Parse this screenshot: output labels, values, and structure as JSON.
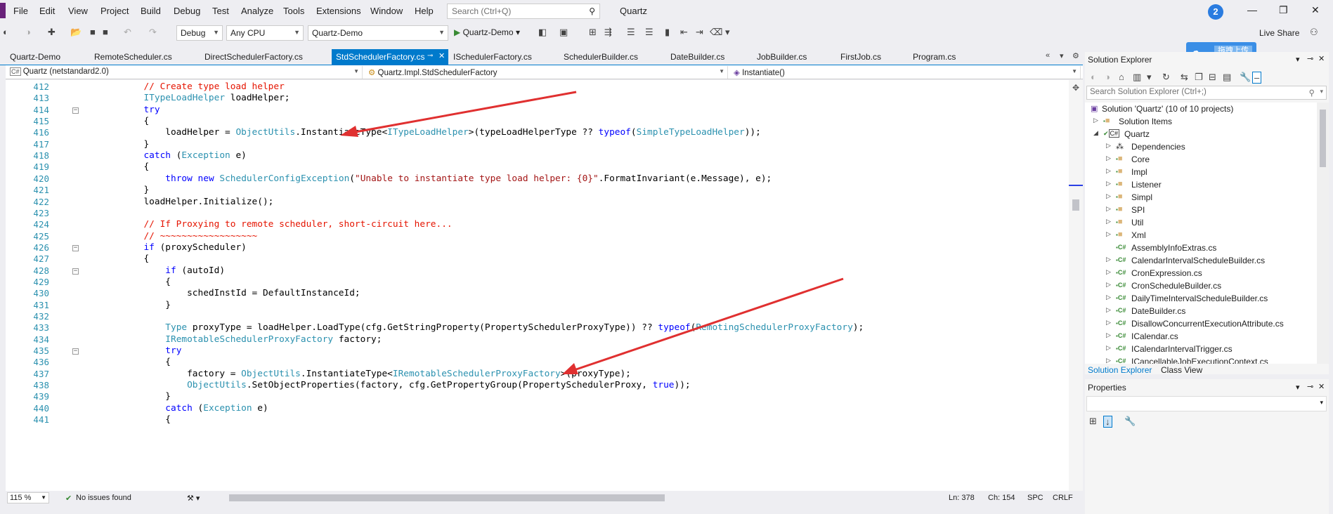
{
  "menubar": {
    "items": [
      "File",
      "Edit",
      "View",
      "Project",
      "Build",
      "Debug",
      "Test",
      "Analyze",
      "Tools",
      "Extensions",
      "Window",
      "Help"
    ],
    "search_placeholder": "Search (Ctrl+Q)",
    "app_title": "Quartz",
    "notification_count": "2",
    "upload_label": "拖拽上传",
    "live_share": "Live Share"
  },
  "toolbar": {
    "config": "Debug",
    "platform": "Any CPU",
    "startup_project": "Quartz-Demo",
    "run_label": "Quartz-Demo"
  },
  "tabs": [
    {
      "label": "Quartz-Demo"
    },
    {
      "label": "RemoteScheduler.cs"
    },
    {
      "label": "DirectSchedulerFactory.cs"
    },
    {
      "label": "StdSchedulerFactory.cs"
    },
    {
      "label": "ISchedulerFactory.cs"
    },
    {
      "label": "SchedulerBuilder.cs"
    },
    {
      "label": "DateBuilder.cs"
    },
    {
      "label": "JobBuilder.cs"
    },
    {
      "label": "FirstJob.cs"
    },
    {
      "label": "Program.cs"
    }
  ],
  "navbar": {
    "project": "Quartz (netstandard2.0)",
    "type": "Quartz.Impl.StdSchedulerFactory",
    "member": "Instantiate()"
  },
  "editor": {
    "line_numbers": [
      "412",
      "413",
      "414",
      "415",
      "416",
      "417",
      "418",
      "419",
      "420",
      "421",
      "422",
      "423",
      "424",
      "425",
      "426",
      "427",
      "428",
      "429",
      "430",
      "431",
      "432",
      "433",
      "434",
      "435",
      "436",
      "437",
      "438",
      "439",
      "440",
      "441"
    ],
    "lines": [
      "            // Create type load helper",
      "            ITypeLoadHelper loadHelper;",
      "            try",
      "            {",
      "                loadHelper = ObjectUtils.InstantiateType<ITypeLoadHelper>(typeLoadHelperType ?? typeof(SimpleTypeLoadHelper));",
      "            }",
      "            catch (Exception e)",
      "            {",
      "                throw new SchedulerConfigException(\"Unable to instantiate type load helper: {0}\".FormatInvariant(e.Message), e);",
      "            }",
      "            loadHelper.Initialize();",
      "",
      "            // If Proxying to remote scheduler, short-circuit here...",
      "            // ~~~~~~~~~~~~~~~~~~",
      "            if (proxyScheduler)",
      "            {",
      "                if (autoId)",
      "                {",
      "                    schedInstId = DefaultInstanceId;",
      "                }",
      "",
      "                Type proxyType = loadHelper.LoadType(cfg.GetStringProperty(PropertySchedulerProxyType)) ?? typeof(RemotingSchedulerProxyFactory);",
      "                IRemotableSchedulerProxyFactory factory;",
      "                try",
      "                {",
      "                    factory = ObjectUtils.InstantiateType<IRemotableSchedulerProxyFactory>(proxyType);",
      "                    ObjectUtils.SetObjectProperties(factory, cfg.GetPropertyGroup(PropertySchedulerProxy, true));",
      "                }",
      "                catch (Exception e)",
      "                {"
    ]
  },
  "statusbar": {
    "zoom": "115 %",
    "issues": "No issues found",
    "line": "Ln: 378",
    "col": "Ch: 154",
    "mode": "SPC",
    "eol": "CRLF"
  },
  "solution_explorer": {
    "title": "Solution Explorer",
    "search_placeholder": "Search Solution Explorer (Ctrl+;)",
    "items": [
      {
        "label": "Solution 'Quartz' (10 of 10 projects)",
        "kind": "solution"
      },
      {
        "label": "Solution Items",
        "kind": "folder"
      },
      {
        "label": "Quartz",
        "kind": "project"
      },
      {
        "label": "Dependencies",
        "kind": "deps"
      },
      {
        "label": "Core",
        "kind": "folder"
      },
      {
        "label": "Impl",
        "kind": "folder"
      },
      {
        "label": "Listener",
        "kind": "folder"
      },
      {
        "label": "Simpl",
        "kind": "folder"
      },
      {
        "label": "SPI",
        "kind": "folder"
      },
      {
        "label": "Util",
        "kind": "folder"
      },
      {
        "label": "Xml",
        "kind": "folder"
      },
      {
        "label": "AssemblyInfoExtras.cs",
        "kind": "file"
      },
      {
        "label": "CalendarIntervalScheduleBuilder.cs",
        "kind": "file"
      },
      {
        "label": "CronExpression.cs",
        "kind": "file"
      },
      {
        "label": "CronScheduleBuilder.cs",
        "kind": "file"
      },
      {
        "label": "DailyTimeIntervalScheduleBuilder.cs",
        "kind": "file"
      },
      {
        "label": "DateBuilder.cs",
        "kind": "file"
      },
      {
        "label": "DisallowConcurrentExecutionAttribute.cs",
        "kind": "file"
      },
      {
        "label": "ICalendar.cs",
        "kind": "file"
      },
      {
        "label": "ICalendarIntervalTrigger.cs",
        "kind": "file"
      },
      {
        "label": "ICancellableJobExecutionContext.cs",
        "kind": "file"
      }
    ],
    "tab_solution": "Solution Explorer",
    "tab_class": "Class View"
  },
  "properties": {
    "title": "Properties"
  },
  "colors": {
    "accent": "#007acc",
    "comment": "#e51400",
    "keyword": "#0000ff",
    "type": "#2b91af",
    "string": "#a31515",
    "arrow": "#e03030"
  }
}
